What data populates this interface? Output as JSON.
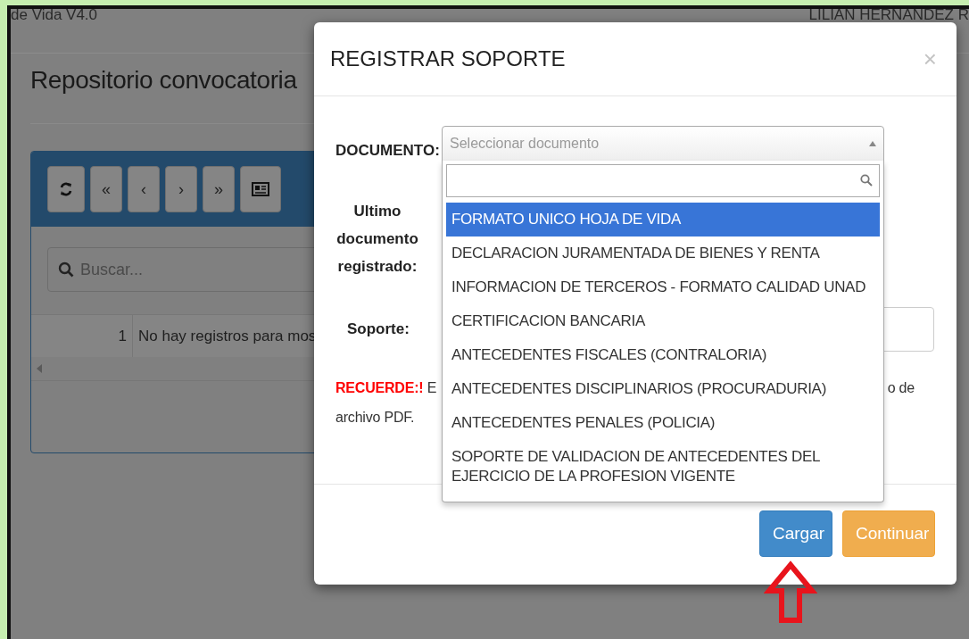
{
  "page": {
    "app_title": "de Vida V4.0",
    "user_name": "LILIAN HERNANDEZ R",
    "heading": "Repositorio convocatoria",
    "toolbar": [
      {
        "kind": "refresh"
      },
      {
        "kind": "text",
        "label": "«"
      },
      {
        "kind": "text",
        "label": "‹"
      },
      {
        "kind": "text",
        "label": "›"
      },
      {
        "kind": "text",
        "label": "»"
      },
      {
        "kind": "card"
      }
    ],
    "search": {
      "placeholder": "Buscar..."
    },
    "table": {
      "rows": [
        {
          "number": "1",
          "message": "No hay registros para mos"
        }
      ]
    }
  },
  "modal": {
    "title": "REGISTRAR SOPORTE",
    "close": "×",
    "document_label": "DOCUMENTO:",
    "select": {
      "placeholder": "Seleccionar documento",
      "expanded": true
    },
    "dropdown": {
      "options": [
        {
          "label": "FORMATO UNICO HOJA DE VIDA",
          "selected": true
        },
        {
          "label": "DECLARACION JURAMENTADA DE BIENES Y RENTA",
          "selected": false
        },
        {
          "label": "INFORMACION DE TERCEROS - FORMATO CALIDAD UNAD",
          "selected": false
        },
        {
          "label": "CERTIFICACION BANCARIA",
          "selected": false
        },
        {
          "label": "ANTECEDENTES FISCALES (CONTRALORIA)",
          "selected": false
        },
        {
          "label": "ANTECEDENTES DISCIPLINARIOS (PROCURADURIA)",
          "selected": false
        },
        {
          "label": "ANTECEDENTES PENALES (POLICIA)",
          "selected": false
        },
        {
          "label": "SOPORTE DE VALIDACION DE ANTECEDENTES DEL EJERCICIO DE LA PROFESION VIGENTE",
          "selected": false
        }
      ]
    },
    "last_document_label": "Ultimo documento registrado:",
    "support_label": "Soporte:",
    "notice": {
      "label": "RECUERDE:!",
      "start": "E",
      "end": "o de",
      "line2": "archivo PDF."
    },
    "buttons": [
      {
        "label": "Cargar",
        "kind": "primary"
      },
      {
        "label": "Continuar",
        "kind": "warning"
      }
    ]
  }
}
